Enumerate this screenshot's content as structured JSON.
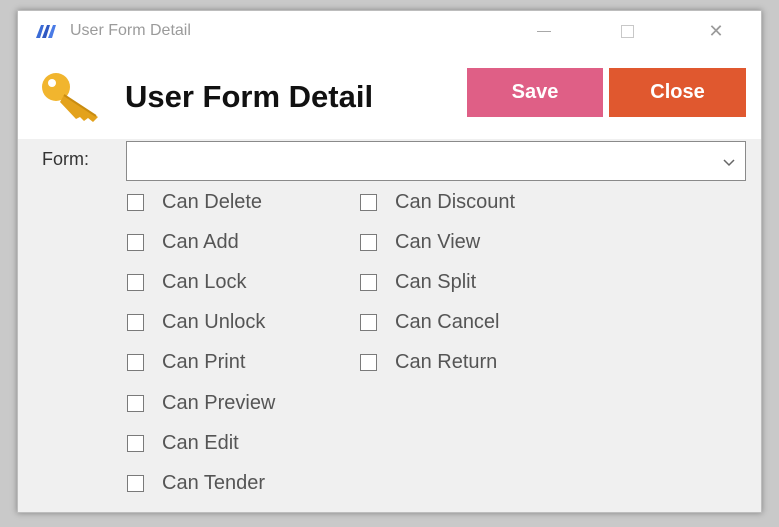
{
  "window": {
    "title": "User Form Detail",
    "controls": {
      "minimize": "minimize",
      "maximize": "maximize",
      "close": "✕"
    }
  },
  "header": {
    "title": "User Form Detail",
    "save_label": "Save",
    "close_label": "Close",
    "save_color": "#df5f86",
    "close_color": "#e0582f"
  },
  "form": {
    "label": "Form:",
    "value": ""
  },
  "permissions": {
    "column1": [
      {
        "label": "Can Delete",
        "checked": false
      },
      {
        "label": "Can Add",
        "checked": false
      },
      {
        "label": "Can Lock",
        "checked": false
      },
      {
        "label": "Can Unlock",
        "checked": false
      },
      {
        "label": "Can Print",
        "checked": false
      },
      {
        "label": "Can Preview",
        "checked": false
      },
      {
        "label": "Can Edit",
        "checked": false
      },
      {
        "label": "Can Tender",
        "checked": false
      }
    ],
    "column2": [
      {
        "label": "Can Discount",
        "checked": false
      },
      {
        "label": "Can View",
        "checked": false
      },
      {
        "label": "Can Split",
        "checked": false
      },
      {
        "label": "Can Cancel",
        "checked": false
      },
      {
        "label": "Can Return",
        "checked": false
      }
    ]
  }
}
